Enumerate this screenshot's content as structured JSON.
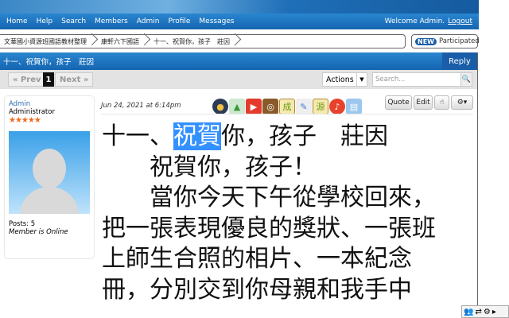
{
  "nav": {
    "items": [
      "Home",
      "Help",
      "Search",
      "Members",
      "Admin",
      "Profile",
      "Messages"
    ],
    "welcome": "Welcome Admin.",
    "logout": "Logout"
  },
  "breadcrumb": [
    "文華國小資源班國語教材整理",
    "康軒六下國語",
    "十一、祝賀你，孩子　莊因"
  ],
  "participated": {
    "badge": "NEW",
    "label": "Participated"
  },
  "thread": {
    "title": "十一、祝賀你，孩子　莊因",
    "reply": "Reply"
  },
  "pager": {
    "prev": "« Prev",
    "page": "1",
    "next": "Next »",
    "actions": "Actions",
    "search_placeholder": "Search..."
  },
  "user": {
    "name": "Admin",
    "role": "Administrator",
    "stars": "★★★★★",
    "posts": "Posts: 5",
    "status": "Member is Online"
  },
  "post": {
    "date": "Jun 24, 2021 at 6:14pm",
    "quote": "Quote",
    "edit": "Edit",
    "title_pre": "十一、",
    "title_hl": "祝賀",
    "title_post": "你，孩子　莊因",
    "lines": [
      "　　祝賀你，孩子！",
      "　　當你今天下午從學校回來，",
      "把一張表現優良的獎狀、一張班",
      "上師生合照的相片、一本紀念",
      "冊，分別交到你母親和我手中"
    ],
    "tool_icons": [
      "成",
      "源"
    ]
  }
}
